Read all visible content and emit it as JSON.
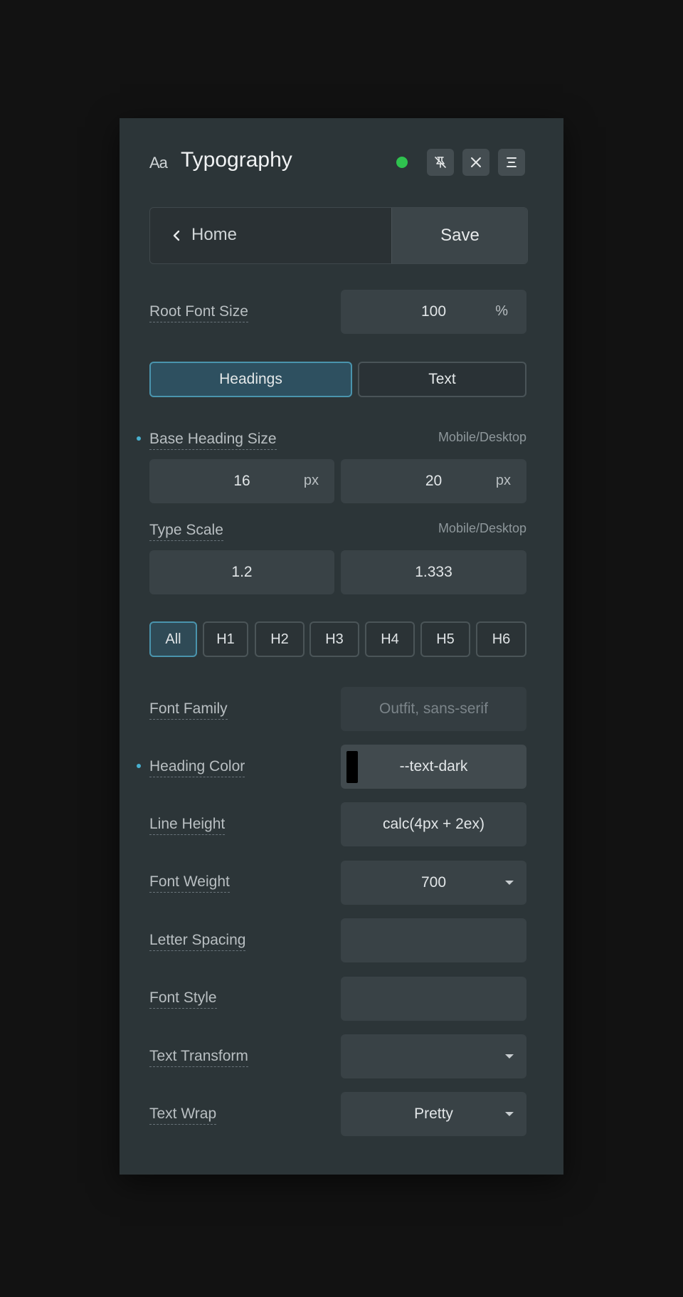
{
  "header": {
    "icon_text": "Aa",
    "title": "Typography",
    "status_color": "#2fc24f"
  },
  "nav": {
    "back_label": "Home",
    "save_label": "Save"
  },
  "root_font_size": {
    "label": "Root Font Size",
    "value": "100",
    "unit": "%"
  },
  "mode_tabs": [
    {
      "label": "Headings",
      "active": true
    },
    {
      "label": "Text",
      "active": false
    }
  ],
  "base_heading_size": {
    "label": "Base Heading Size",
    "hint": "Mobile/Desktop",
    "mobile": "16",
    "mobile_unit": "px",
    "desktop": "20",
    "desktop_unit": "px"
  },
  "type_scale": {
    "label": "Type Scale",
    "hint": "Mobile/Desktop",
    "mobile": "1.2",
    "desktop": "1.333"
  },
  "heading_tabs": [
    "All",
    "H1",
    "H2",
    "H3",
    "H4",
    "H5",
    "H6"
  ],
  "properties": {
    "font_family": {
      "label": "Font Family",
      "placeholder": "Outfit, sans-serif"
    },
    "heading_color": {
      "label": "Heading Color",
      "value": "--text-dark",
      "swatch": "#000000"
    },
    "line_height": {
      "label": "Line Height",
      "value": "calc(4px + 2ex)"
    },
    "font_weight": {
      "label": "Font Weight",
      "value": "700"
    },
    "letter_spacing": {
      "label": "Letter Spacing",
      "value": ""
    },
    "font_style": {
      "label": "Font Style",
      "value": ""
    },
    "text_transform": {
      "label": "Text Transform",
      "value": ""
    },
    "text_wrap": {
      "label": "Text Wrap",
      "value": "Pretty"
    }
  },
  "colors": {
    "accent": "#4a94ad",
    "panel_bg": "#2c3538",
    "page_bg": "#121212"
  }
}
